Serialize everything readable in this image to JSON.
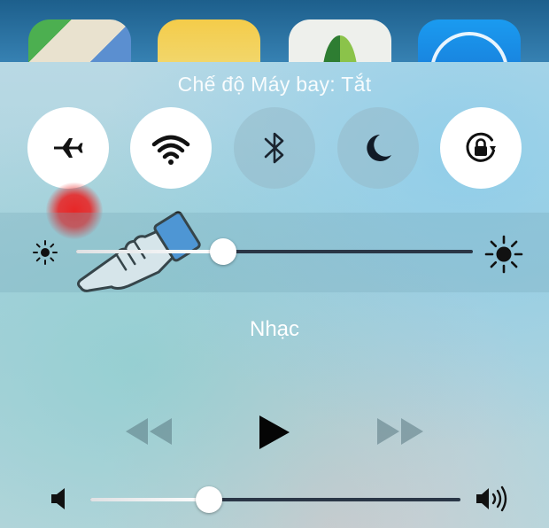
{
  "status": {
    "airplane_mode_text": "Chế độ Máy bay: Tắt"
  },
  "toggles": [
    {
      "name": "airplane-mode",
      "icon": "airplane-icon",
      "state": "on-highlighted"
    },
    {
      "name": "wifi",
      "icon": "wifi-icon",
      "state": "on"
    },
    {
      "name": "bluetooth",
      "icon": "bluetooth-icon",
      "state": "off"
    },
    {
      "name": "do-not-disturb",
      "icon": "moon-icon",
      "state": "off"
    },
    {
      "name": "rotation-lock",
      "icon": "rotation-lock-icon",
      "state": "on"
    }
  ],
  "brightness": {
    "value": 0.37,
    "icon_low": "sun-small-icon",
    "icon_high": "sun-large-icon"
  },
  "music": {
    "title": "Nhạc",
    "controls": [
      "rewind-icon",
      "play-icon",
      "fast-forward-icon"
    ]
  },
  "volume": {
    "value": 0.32,
    "icon_low": "speaker-low-icon",
    "icon_high": "speaker-high-icon"
  },
  "colors": {
    "toggle_on": "#ffffff",
    "toggle_off": "#96b9c8",
    "touch_indicator": "#eb1e1e",
    "hand_cuff": "#3d8fe0",
    "track": "#2a3646"
  }
}
